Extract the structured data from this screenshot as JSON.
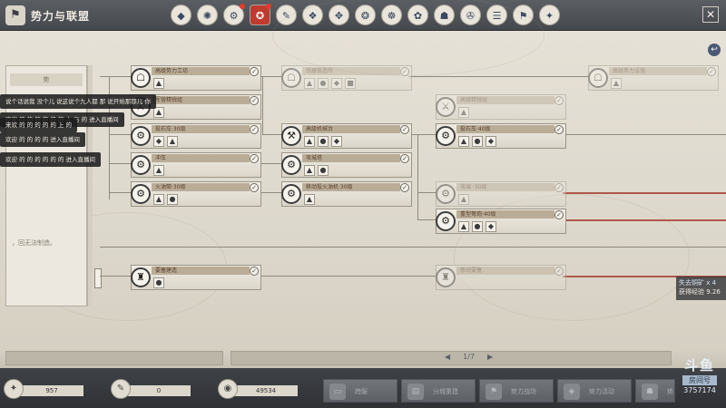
{
  "app": {
    "title": "势力与联盟",
    "icon": "banner-icon"
  },
  "top_icons": [
    {
      "name": "top-icon-1",
      "glyph": "◆",
      "badge": false,
      "active": false
    },
    {
      "name": "top-icon-2",
      "glyph": "✺",
      "badge": false,
      "active": false
    },
    {
      "name": "top-icon-3",
      "glyph": "⚙",
      "badge": true,
      "active": false
    },
    {
      "name": "top-icon-4",
      "glyph": "✪",
      "badge": true,
      "active": true
    },
    {
      "name": "top-icon-5",
      "glyph": "✎",
      "badge": false,
      "active": false
    },
    {
      "name": "top-icon-6",
      "glyph": "❖",
      "badge": false,
      "active": false
    },
    {
      "name": "top-icon-7",
      "glyph": "✥",
      "badge": false,
      "active": false
    },
    {
      "name": "top-icon-8",
      "glyph": "❂",
      "badge": false,
      "active": false
    },
    {
      "name": "top-icon-9",
      "glyph": "☸",
      "badge": false,
      "active": false
    },
    {
      "name": "top-icon-10",
      "glyph": "✿",
      "badge": false,
      "active": false
    },
    {
      "name": "top-icon-11",
      "glyph": "☗",
      "badge": false,
      "active": false
    },
    {
      "name": "top-icon-12",
      "glyph": "✇",
      "badge": false,
      "active": false
    },
    {
      "name": "top-icon-13",
      "glyph": "☰",
      "badge": false,
      "active": false
    },
    {
      "name": "top-icon-14",
      "glyph": "⚑",
      "badge": false,
      "active": false
    },
    {
      "name": "top-icon-15",
      "glyph": "✦",
      "badge": false,
      "active": false
    }
  ],
  "chat": [
    "说个话说我 没个儿 说这说个九人都 那 说开始那那儿 你",
    "欢迎 的 的 的 的 的 的 人 与 的 进入直播间",
    "来欢 的 的 的 的 的 上 的",
    "欢迎 的 的 的 的 进入直播间",
    "欢迎 的 的 的 的 的 的 进入直播间"
  ],
  "left_panel": {
    "tab": "势",
    "text": "，回无法制造。"
  },
  "nodes": [
    {
      "id": "n1",
      "label": "高级势力工坊",
      "items": [
        "▲"
      ],
      "dim": false,
      "medal": "☖"
    },
    {
      "id": "n2",
      "label": "军营精锐组",
      "items": [
        "▲"
      ],
      "dim": false,
      "medal": "⚔"
    },
    {
      "id": "n3",
      "label": "投石车·30级",
      "items": [
        "◆",
        "▲"
      ],
      "dim": false,
      "medal": "⚙"
    },
    {
      "id": "n4",
      "label": "冲车",
      "items": [
        "▲"
      ],
      "dim": false,
      "medal": "⚙"
    },
    {
      "id": "n5",
      "label": "火油筒·30级",
      "items": [
        "▲",
        "●"
      ],
      "dim": false,
      "medal": "⚙"
    },
    {
      "id": "n6",
      "label": "高级机械台",
      "items": [
        "▲",
        "●",
        "◆"
      ],
      "dim": false,
      "medal": "⚒"
    },
    {
      "id": "n7",
      "label": "攻城塔",
      "items": [
        "▲",
        "●"
      ],
      "dim": false,
      "medal": "⚙"
    },
    {
      "id": "n8",
      "label": "移动投火油机·30级",
      "items": [
        "▲"
      ],
      "dim": false,
      "medal": "⚙"
    },
    {
      "id": "n9",
      "label": "铁器锻造所",
      "items": [
        "▲",
        "●",
        "◆",
        "■"
      ],
      "dim": true,
      "medal": "☖"
    },
    {
      "id": "n10",
      "label": "高级精锐组",
      "items": [
        "▲"
      ],
      "dim": true,
      "medal": "⚔"
    },
    {
      "id": "n11",
      "label": "投石车·40级",
      "items": [
        "▲",
        "●",
        "◆"
      ],
      "dim": false,
      "medal": "⚙"
    },
    {
      "id": "n12",
      "label": "攻城 ·30级",
      "items": [
        "▲"
      ],
      "dim": true,
      "medal": "⚙"
    },
    {
      "id": "n13",
      "label": "重型弩炮·40级",
      "items": [
        "▲",
        "●",
        "◆"
      ],
      "dim": false,
      "medal": "⚙"
    },
    {
      "id": "n14",
      "label": "高级势力设施",
      "items": [
        "▲"
      ],
      "dim": true,
      "medal": "☖"
    },
    {
      "id": "n15",
      "label": "要塞建造",
      "items": [
        "●"
      ],
      "dim": false,
      "medal": "♜"
    },
    {
      "id": "n16",
      "label": "移动要塞",
      "items": [],
      "dim": true,
      "medal": "♜"
    }
  ],
  "reward": {
    "line1": "失去铜矿 x 4",
    "line2": "获得经验 9.26"
  },
  "pager": {
    "prev": "◀",
    "page": "1/7",
    "next": "▶"
  },
  "resources": [
    {
      "name": "resource-silver",
      "glyph": "✦",
      "value": "957"
    },
    {
      "name": "resource-contribution",
      "glyph": "✎",
      "value": "0"
    },
    {
      "name": "resource-funds",
      "glyph": "◉",
      "value": "49534"
    }
  ],
  "bottom_buttons": [
    {
      "name": "btn-1",
      "label": "跨服",
      "glyph": "▭"
    },
    {
      "name": "btn-2",
      "label": "分城重建",
      "glyph": "▤"
    },
    {
      "name": "btn-3",
      "label": "势力战场",
      "glyph": "⚑"
    },
    {
      "name": "btn-4",
      "label": "势力活动",
      "glyph": "◈"
    },
    {
      "name": "btn-5",
      "label": "势力",
      "glyph": "☗"
    }
  ],
  "watermark": {
    "brand": "斗鱼",
    "room_label": "房间号",
    "room_id": "3757174"
  }
}
